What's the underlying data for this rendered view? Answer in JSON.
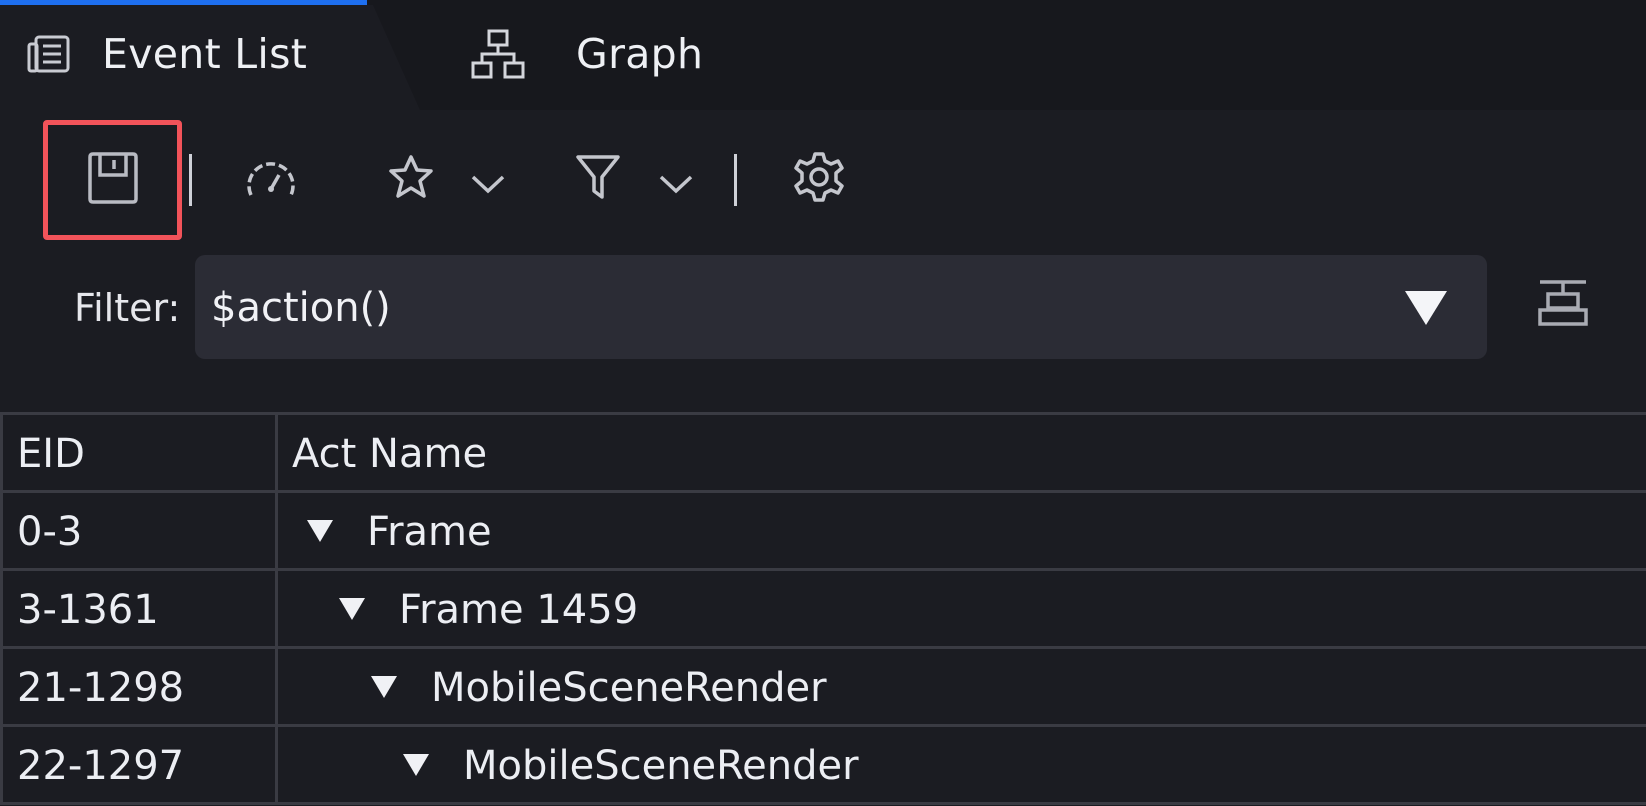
{
  "tabs": [
    {
      "label": "Event List",
      "icon": "list-icon",
      "active": true
    },
    {
      "label": "Graph",
      "icon": "graph-icon",
      "active": false
    }
  ],
  "colors": {
    "accent": "#1e6ff0",
    "highlight": "#f2535a",
    "background": "#1b1c22",
    "tabstrip": "#17181d",
    "filter_box": "#2b2c35",
    "grid": "#3a3b43"
  },
  "toolbar": {
    "icons": [
      "save-icon",
      "gauge-icon",
      "star-icon",
      "chevron-down-icon",
      "filter-icon",
      "chevron-down-icon",
      "gear-icon"
    ]
  },
  "filter": {
    "label": "Filter:",
    "value": "$action()"
  },
  "table": {
    "columns": [
      "EID",
      "Act Name"
    ],
    "rows": [
      {
        "eid": "0-3",
        "name": "Frame",
        "depth": 0
      },
      {
        "eid": "3-1361",
        "name": "Frame 1459",
        "depth": 1
      },
      {
        "eid": "21-1298",
        "name": "MobileSceneRender",
        "depth": 2
      },
      {
        "eid": "22-1297",
        "name": "MobileSceneRender",
        "depth": 3
      }
    ]
  }
}
